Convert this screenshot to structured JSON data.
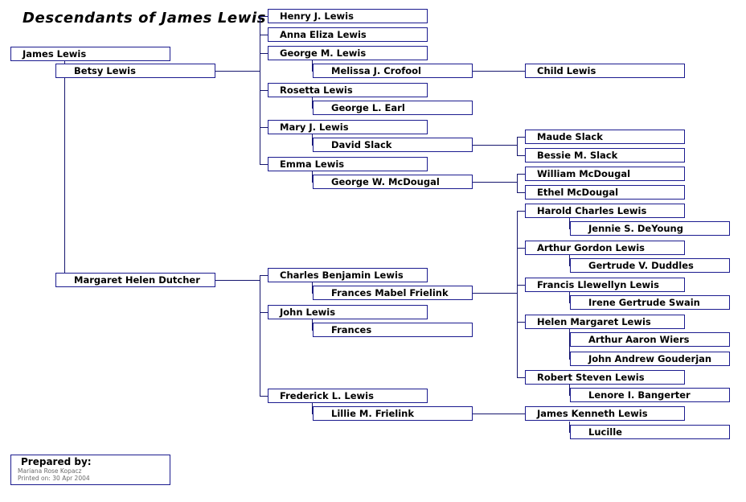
{
  "chart": {
    "title": "Descendants of James Lewis",
    "accent_color": "#1b1b8f",
    "line_color": "#16166e",
    "background": "#ffffff"
  },
  "prepared": {
    "heading": "Prepared by:",
    "author": "Mariana Rose Kopacz",
    "printed": "Printed on: 30 Apr 2004"
  },
  "nodes": {
    "root": "James Lewis",
    "spouse1": "Betsy Lewis",
    "spouse2": "Margaret Helen Dutcher",
    "g2_henry": "Henry J. Lewis",
    "g2_anna": "Anna Eliza Lewis",
    "g2_george": "George M. Lewis",
    "g2_george_spouse": "Melissa J. Crofool",
    "g2_rosetta": "Rosetta Lewis",
    "g2_rosetta_spouse": "George L. Earl",
    "g2_mary": "Mary J. Lewis",
    "g2_mary_spouse": "David Slack",
    "g2_emma": "Emma Lewis",
    "g2_emma_spouse": "George W. McDougal",
    "g2_charles": "Charles Benjamin Lewis",
    "g2_charles_spouse": "Frances Mabel Frielink",
    "g2_john": "John Lewis",
    "g2_john_spouse": "Frances",
    "g2_frederick": "Frederick L. Lewis",
    "g2_frederick_spouse": "Lillie M. Frielink",
    "g3_child": "Child Lewis",
    "g3_maude": "Maude Slack",
    "g3_bessie": "Bessie M. Slack",
    "g3_william": "William McDougal",
    "g3_ethel": "Ethel McDougal",
    "g3_harold": "Harold Charles Lewis",
    "g3_harold_spouse": "Jennie S. DeYoung",
    "g3_arthur": "Arthur Gordon Lewis",
    "g3_arthur_spouse": "Gertrude V. Duddles",
    "g3_francis": "Francis Llewellyn Lewis",
    "g3_francis_spouse": "Irene Gertrude Swain",
    "g3_helen": "Helen Margaret Lewis",
    "g3_helen_spouse1": "Arthur Aaron Wiers",
    "g3_helen_spouse2": "John Andrew Gouderjan",
    "g3_robert": "Robert Steven Lewis",
    "g3_robert_spouse": "Lenore I. Bangerter",
    "g3_jameskenneth": "James Kenneth Lewis",
    "g3_jameskenneth_spouse": "Lucille"
  }
}
